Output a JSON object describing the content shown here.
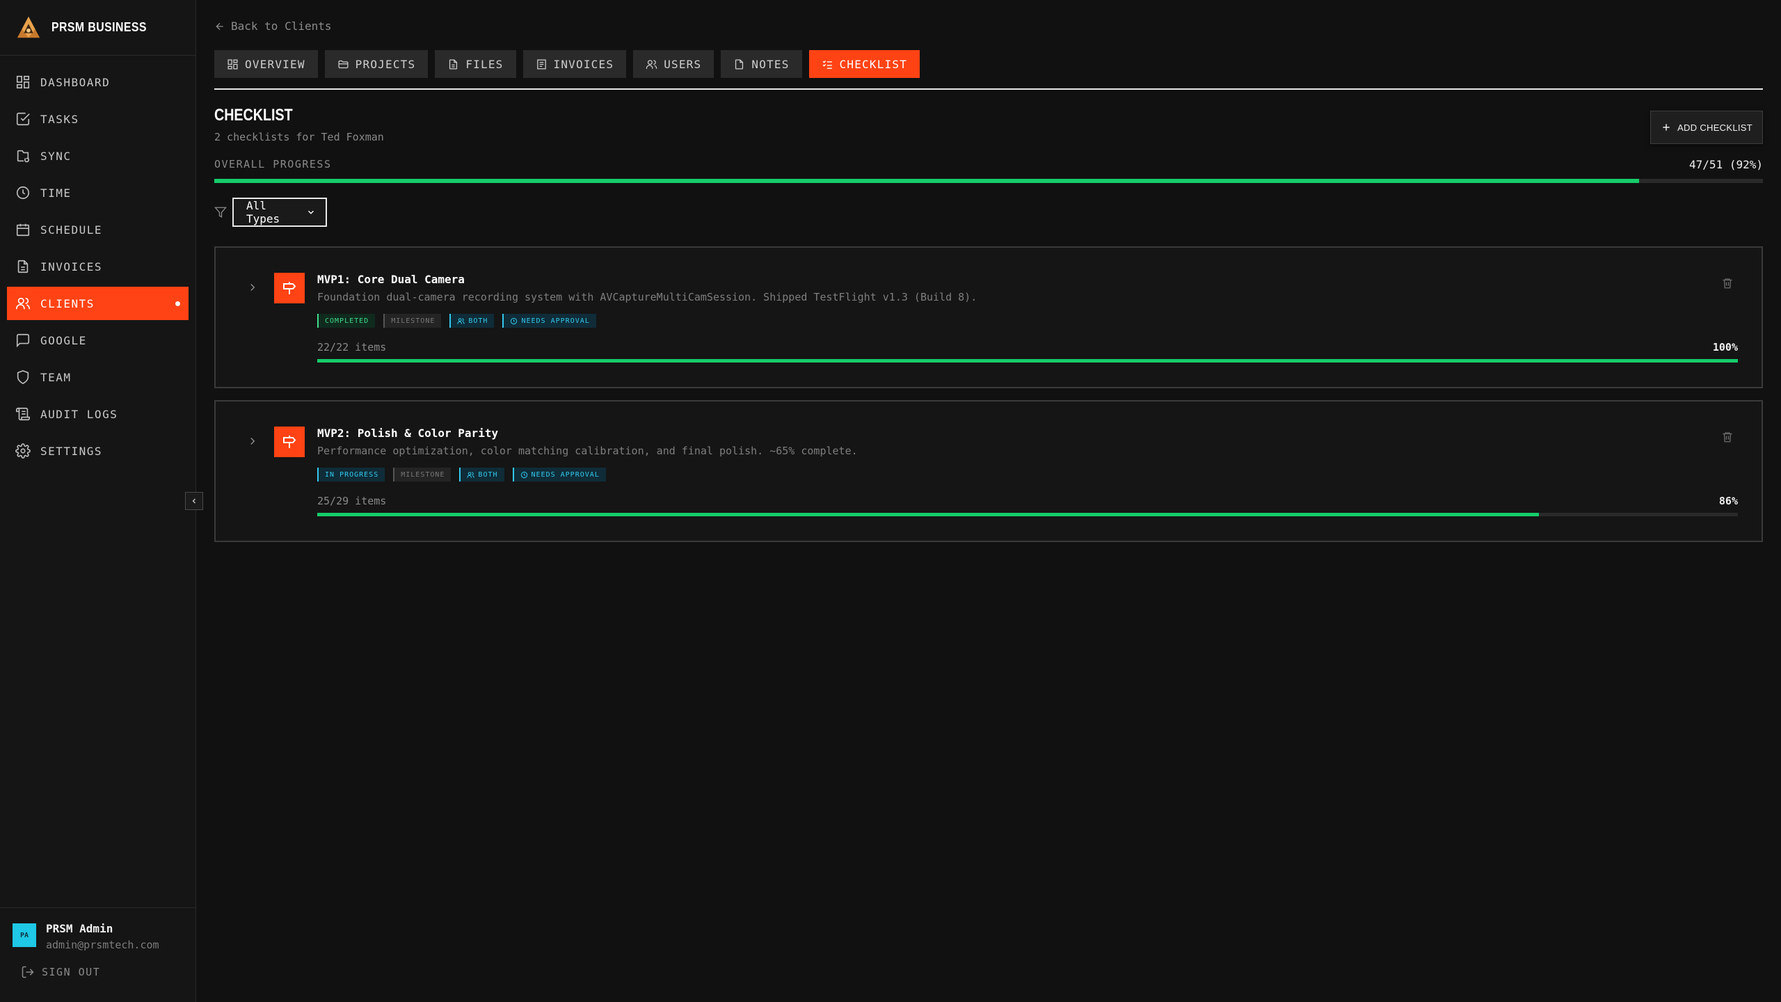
{
  "brand": {
    "name": "PRSM BUSINESS"
  },
  "sidebar": {
    "items": [
      {
        "label": "DASHBOARD",
        "icon": "dashboard-icon"
      },
      {
        "label": "TASKS",
        "icon": "tasks-icon"
      },
      {
        "label": "SYNC",
        "icon": "sync-icon"
      },
      {
        "label": "TIME",
        "icon": "clock-icon"
      },
      {
        "label": "SCHEDULE",
        "icon": "calendar-icon"
      },
      {
        "label": "INVOICES",
        "icon": "document-icon"
      },
      {
        "label": "CLIENTS",
        "icon": "users-icon",
        "active": true
      },
      {
        "label": "GOOGLE",
        "icon": "chat-icon"
      },
      {
        "label": "TEAM",
        "icon": "shield-icon"
      },
      {
        "label": "AUDIT LOGS",
        "icon": "scroll-icon"
      },
      {
        "label": "SETTINGS",
        "icon": "gear-icon"
      }
    ]
  },
  "user": {
    "initials": "PA",
    "name": "PRSM Admin",
    "email": "admin@prsmtech.com",
    "signout": "SIGN OUT"
  },
  "header": {
    "back_label": "Back to Clients",
    "tabs": [
      {
        "label": "OVERVIEW",
        "icon": "grid-icon"
      },
      {
        "label": "PROJECTS",
        "icon": "folder-icon"
      },
      {
        "label": "FILES",
        "icon": "file-icon"
      },
      {
        "label": "INVOICES",
        "icon": "receipt-icon"
      },
      {
        "label": "USERS",
        "icon": "users-icon"
      },
      {
        "label": "NOTES",
        "icon": "note-icon"
      },
      {
        "label": "CHECKLIST",
        "icon": "checklist-icon",
        "active": true
      }
    ]
  },
  "checklist": {
    "title": "CHECKLIST",
    "subtitle": "2 checklists for Ted Foxman",
    "add_label": "ADD CHECKLIST",
    "progress_label": "OVERALL PROGRESS",
    "progress_value": "47/51 (92%)",
    "progress_fraction": 0.92,
    "filter_value": "All Types",
    "cards": [
      {
        "title": "MVP1: Core Dual Camera",
        "description": "Foundation dual-camera recording system with AVCaptureMultiCamSession. Shipped TestFlight v1.3 (Build 8).",
        "status": "COMPLETED",
        "type": "MILESTONE",
        "audience": "BOTH",
        "approval": "NEEDS APPROVAL",
        "items": "22/22 items",
        "percent": "100%",
        "fraction": 1.0
      },
      {
        "title": "MVP2: Polish & Color Parity",
        "description": "Performance optimization, color matching calibration, and final polish. ~65% complete.",
        "status": "IN PROGRESS",
        "type": "MILESTONE",
        "audience": "BOTH",
        "approval": "NEEDS APPROVAL",
        "items": "25/29 items",
        "percent": "86%",
        "fraction": 0.86
      }
    ]
  },
  "colors": {
    "accent": "#ff4314",
    "progress": "#16cc6a",
    "info": "#34c9ee",
    "success": "#3fdc8a"
  }
}
